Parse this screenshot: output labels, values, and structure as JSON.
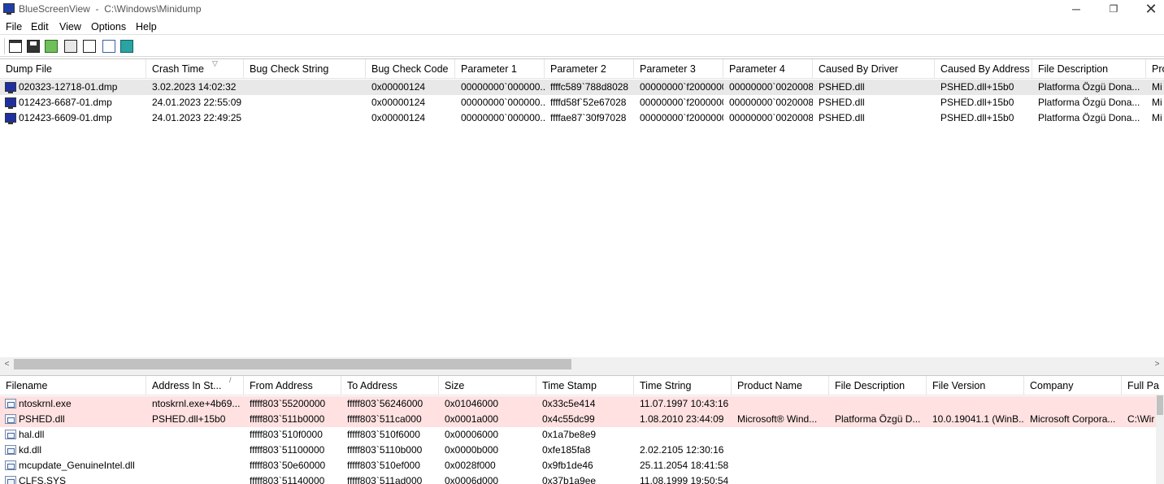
{
  "window": {
    "app_name": "BlueScreenView",
    "path": "C:\\Windows\\Minidump",
    "minimize_glyph": "─",
    "maximize_glyph": "❐",
    "close_glyph": "✕"
  },
  "menu": [
    "File",
    "Edit",
    "View",
    "Options",
    "Help"
  ],
  "toolbar": {
    "icons": [
      "html-report-icon",
      "save-icon",
      "refresh-icon",
      "copy-icon",
      "properties-icon",
      "find-icon",
      "exit-icon"
    ]
  },
  "dumps": {
    "columns": [
      "Dump File",
      "Crash Time",
      "Bug Check String",
      "Bug Check Code",
      "Parameter 1",
      "Parameter 2",
      "Parameter 3",
      "Parameter 4",
      "Caused By Driver",
      "Caused By Address",
      "File Description",
      "Pro"
    ],
    "sort_indicator": "▽",
    "rows": [
      [
        "020323-12718-01.dmp",
        "3.02.2023 14:02:32",
        "",
        "0x00000124",
        "00000000`000000...",
        "ffffc589`788d8028",
        "00000000`f2000000",
        "00000000`0020008f",
        "PSHED.dll",
        "PSHED.dll+15b0",
        "Platforma Özgü Dona...",
        "Mi"
      ],
      [
        "012423-6687-01.dmp",
        "24.01.2023 22:55:09",
        "",
        "0x00000124",
        "00000000`000000...",
        "ffffd58f`52e67028",
        "00000000`f2000000",
        "00000000`0020008f",
        "PSHED.dll",
        "PSHED.dll+15b0",
        "Platforma Özgü Dona...",
        "Mi"
      ],
      [
        "012423-6609-01.dmp",
        "24.01.2023 22:49:25",
        "",
        "0x00000124",
        "00000000`000000...",
        "ffffae87`30f97028",
        "00000000`f2000000",
        "00000000`0020008f",
        "PSHED.dll",
        "PSHED.dll+15b0",
        "Platforma Özgü Dona...",
        "Mi"
      ]
    ]
  },
  "scrollbar": {
    "left_arrow": "<",
    "right_arrow": ">"
  },
  "modules": {
    "columns": [
      "Filename",
      "Address In St...",
      "From Address",
      "To Address",
      "Size",
      "Time Stamp",
      "Time String",
      "Product Name",
      "File Description",
      "File Version",
      "Company",
      "Full Pa"
    ],
    "sort_indicator": "/",
    "rows": [
      [
        "ntoskrnl.exe",
        "ntoskrnl.exe+4b69...",
        "fffff803`55200000",
        "fffff803`56246000",
        "0x01046000",
        "0x33c5e414",
        "11.07.1997 10:43:16",
        "",
        "",
        "",
        "",
        ""
      ],
      [
        "PSHED.dll",
        "PSHED.dll+15b0",
        "fffff803`511b0000",
        "fffff803`511ca000",
        "0x0001a000",
        "0x4c55dc99",
        "1.08.2010 23:44:09",
        "Microsoft® Wind...",
        "Platforma Özgü D...",
        "10.0.19041.1 (WinB...",
        "Microsoft Corpora...",
        "C:\\Wir"
      ],
      [
        "hal.dll",
        "",
        "fffff803`510f0000",
        "fffff803`510f6000",
        "0x00006000",
        "0x1a7be8e9",
        "",
        "",
        "",
        "",
        "",
        ""
      ],
      [
        "kd.dll",
        "",
        "fffff803`51100000",
        "fffff803`5110b000",
        "0x0000b000",
        "0xfe185fa8",
        "2.02.2105 12:30:16",
        "",
        "",
        "",
        "",
        ""
      ],
      [
        "mcupdate_GenuineIntel.dll",
        "",
        "fffff803`50e60000",
        "fffff803`510ef000",
        "0x0028f000",
        "0x9fb1de46",
        "25.11.2054 18:41:58",
        "",
        "",
        "",
        "",
        ""
      ],
      [
        "CLFS.SYS",
        "",
        "fffff803`51140000",
        "fffff803`511ad000",
        "0x0006d000",
        "0x37b1a9ee",
        "11.08.1999 19:50:54",
        "",
        "",
        "",
        "",
        ""
      ]
    ]
  }
}
